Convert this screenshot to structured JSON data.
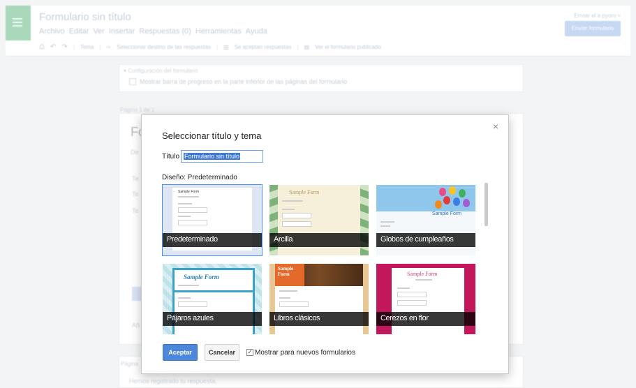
{
  "header": {
    "doc_title": "Formulario sin título",
    "menu": [
      "Archivo",
      "Editar",
      "Ver",
      "Insertar",
      "Respuestas (0)",
      "Herramientas",
      "Ayuda"
    ],
    "toolbar": {
      "theme": "Tema",
      "destination": "Seleccionar destino de las respuestas",
      "accepting": "Se aceptan respuestas",
      "view_published": "Ver el formulario publicado"
    },
    "share_link": "Enviar el a pyoro ≈",
    "send_button": "Enviar formulario"
  },
  "background": {
    "settings_header": "▾ Configuración del formulario",
    "progress_bar": "Mostrar barra de progreso en la parte inferior de las páginas del formulario",
    "page_label": "Página 1 de 1",
    "page_title": "Fo",
    "frag_1": "De",
    "frag_2": "Te",
    "frag_3": "Te",
    "frag_4": "Añ",
    "footer_page_label": "Página",
    "footer_confirm": "Hemos registrado tu respuesta."
  },
  "dialog": {
    "title": "Seleccionar título y tema",
    "title_label": "Título",
    "title_value": "Formulario sin título",
    "design_label": "Diseño: Predeterminado",
    "themes": [
      {
        "name": "Predeterminado"
      },
      {
        "name": "Arcilla"
      },
      {
        "name": "Globos de cumpleaños"
      },
      {
        "name": "Pájaros azules"
      },
      {
        "name": "Libros clásicos"
      },
      {
        "name": "Cerezos en flor"
      }
    ],
    "thumb_text": "Sample Form",
    "accept": "Aceptar",
    "cancel": "Cancelar",
    "show_for_new": "Mostrar para nuevos formularios",
    "close": "×",
    "checkmark": "✓"
  }
}
